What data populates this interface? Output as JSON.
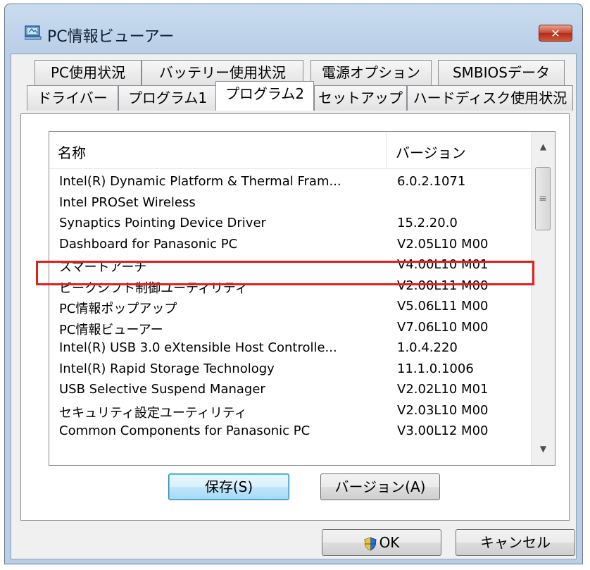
{
  "window": {
    "title": "PC情報ビューアー",
    "close_label": "✕"
  },
  "tabs_row1": [
    "PC使用状況",
    "バッテリー使用状況",
    "電源オプション",
    "SMBIOSデータ"
  ],
  "tabs_row2": [
    "ドライバー",
    "プログラム1",
    "プログラム2",
    "セットアップ",
    "ハードディスク使用状況"
  ],
  "active_tab": "プログラム2",
  "list": {
    "columns": [
      "名称",
      "バージョン"
    ],
    "rows": [
      [
        "Intel(R) Dynamic Platform & Thermal Fram...",
        "6.0.2.1071"
      ],
      [
        "Intel PROSet Wireless",
        ""
      ],
      [
        "Synaptics Pointing Device Driver",
        "15.2.20.0"
      ],
      [
        "Dashboard for Panasonic PC",
        "V2.05L10 M00"
      ],
      [
        "スマートアーチ",
        "V4.00L10 M01"
      ],
      [
        "ピークシフト制御ユーティリティ",
        "V2.00L11 M00"
      ],
      [
        "PC情報ポップアップ",
        "V5.06L11 M00"
      ],
      [
        "PC情報ビューアー",
        "V7.06L10 M00"
      ],
      [
        "Intel(R) USB 3.0 eXtensible Host Controlle...",
        "1.0.4.220"
      ],
      [
        "Intel(R) Rapid Storage Technology",
        "11.1.0.1006"
      ],
      [
        "USB Selective Suspend Manager",
        "V2.02L10 M01"
      ],
      [
        "セキュリティ設定ユーティリティ",
        "V2.03L10 M00"
      ],
      [
        "Common Components for Panasonic PC",
        "V3.00L12 M00"
      ]
    ],
    "highlighted_row": "スマートアーチ"
  },
  "buttons": {
    "save": "保存(S)",
    "version": "バージョン(A)",
    "ok": "OK",
    "cancel": "キャンセル"
  },
  "colors": {
    "highlight": "#e0201a",
    "accent": "#3c7fb1"
  },
  "icons": [
    "app-icon",
    "close-icon",
    "scroll-up-icon",
    "scroll-down-icon",
    "scroll-grip-icon",
    "shield-icon"
  ]
}
